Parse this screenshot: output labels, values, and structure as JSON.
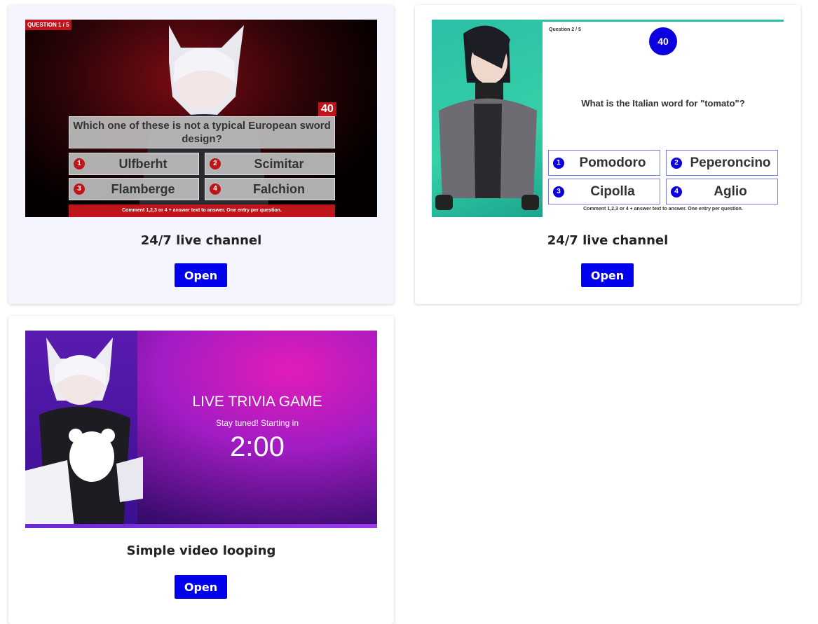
{
  "cards": [
    {
      "title": "24/7 live channel",
      "button": "Open",
      "thumbnail": {
        "question_badge": "QUESTION 1 / 5",
        "timer": "40",
        "question": "Which one of these is not a typical European sword design?",
        "answers": [
          {
            "num": "1",
            "text": "Ulfberht"
          },
          {
            "num": "2",
            "text": "Scimitar"
          },
          {
            "num": "3",
            "text": "Flamberge"
          },
          {
            "num": "4",
            "text": "Falchion"
          }
        ],
        "footer": "Comment 1,2,3 or 4 + answer text to answer. One entry per question."
      }
    },
    {
      "title": "24/7 live channel",
      "button": "Open",
      "thumbnail": {
        "question_badge": "Question 2 / 5",
        "timer": "40",
        "question": "What is the Italian word for \"tomato\"?",
        "answers": [
          {
            "num": "1",
            "text": "Pomodoro"
          },
          {
            "num": "2",
            "text": "Peperoncino"
          },
          {
            "num": "3",
            "text": "Cipolla"
          },
          {
            "num": "4",
            "text": "Aglio"
          }
        ],
        "footer": "Comment 1,2,3 or 4 + answer text to answer. One entry per question."
      }
    },
    {
      "title": "Simple video looping",
      "button": "Open",
      "thumbnail": {
        "heading": "LIVE TRIVIA GAME",
        "subheading": "Stay tuned! Starting in",
        "countdown": "2:00"
      }
    }
  ],
  "colors": {
    "button": "#0000ee",
    "quiz_red": "#c0141c",
    "quiz_blue": "#0a00e0",
    "teal": "#2bbfa6",
    "magenta": "#e21cb8"
  }
}
